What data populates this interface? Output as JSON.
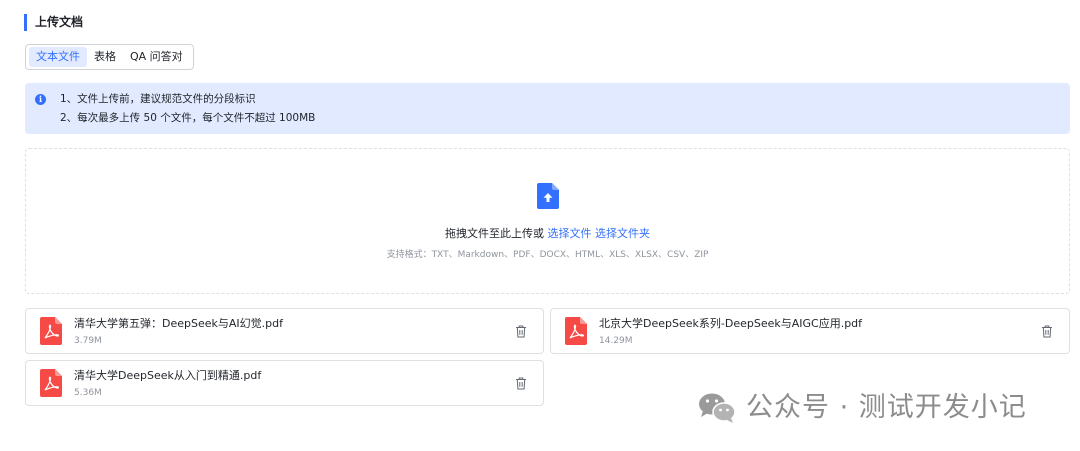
{
  "section": {
    "title": "上传文档"
  },
  "tabs": [
    {
      "label": "文本文件",
      "active": true
    },
    {
      "label": "表格",
      "active": false
    },
    {
      "label": "QA 问答对",
      "active": false
    }
  ],
  "notice": {
    "icon": "info-icon",
    "lines": [
      "1、文件上传前，建议规范文件的分段标识",
      "2、每次最多上传 50 个文件，每个文件不超过 100MB"
    ]
  },
  "dropzone": {
    "icon": "upload-file-icon",
    "text": "拖拽文件至此上传或",
    "select_file": "选择文件",
    "select_folder": "选择文件夹",
    "formats": "支持格式：TXT、Markdown、PDF、DOCX、HTML、XLS、XLSX、CSV、ZIP"
  },
  "files": [
    {
      "name": "清华大学第五弹：DeepSeek与AI幻觉.pdf",
      "size": "3.79M",
      "icon": "pdf-icon"
    },
    {
      "name": "北京大学DeepSeek系列-DeepSeek与AIGC应用.pdf",
      "size": "14.29M",
      "icon": "pdf-icon"
    },
    {
      "name": "清华大学DeepSeek从入门到精通.pdf",
      "size": "5.36M",
      "icon": "pdf-icon"
    }
  ],
  "watermark": {
    "text": "公众号 · 测试开发小记"
  },
  "colors": {
    "accent": "#3370ff",
    "notice_bg": "#e1eaff",
    "pdf_red": "#f54a45",
    "border": "#dee0e3",
    "muted": "#8f959e"
  }
}
